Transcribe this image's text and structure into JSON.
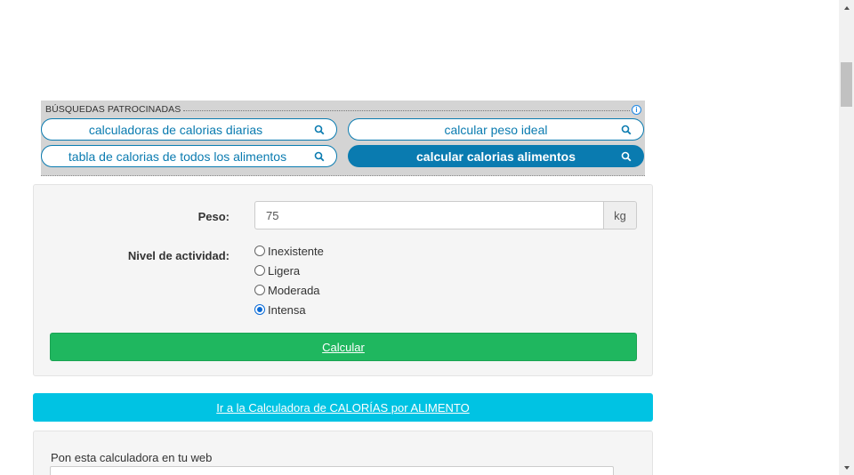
{
  "sponsored": {
    "label": "BÚSQUEDAS PATROCINADAS",
    "info_icon": "info-icon",
    "items": [
      {
        "label": "calculadoras de calorias diarias",
        "style": "outline"
      },
      {
        "label": "calcular peso ideal",
        "style": "outline"
      },
      {
        "label": "tabla de calorias de todos los alimentos",
        "style": "outline"
      },
      {
        "label": "calcular calorias alimentos",
        "style": "filled"
      }
    ]
  },
  "form": {
    "weight_label": "Peso:",
    "weight_value": "75",
    "weight_unit": "kg",
    "activity_label": "Nivel de actividad:",
    "activity_options": [
      "Inexistente",
      "Ligera",
      "Moderada",
      "Intensa"
    ],
    "activity_selected": "Intensa",
    "submit_label": "Calcular"
  },
  "links": {
    "food_calculator": "Ir a la Calculadora de CALORÍAS por ALIMENTO"
  },
  "embed": {
    "label": "Pon esta calculadora en tu web"
  },
  "colors": {
    "accent_blue": "#0a7bb0",
    "calculate_green": "#1fb75f",
    "cyan_link": "#00c3e3"
  }
}
